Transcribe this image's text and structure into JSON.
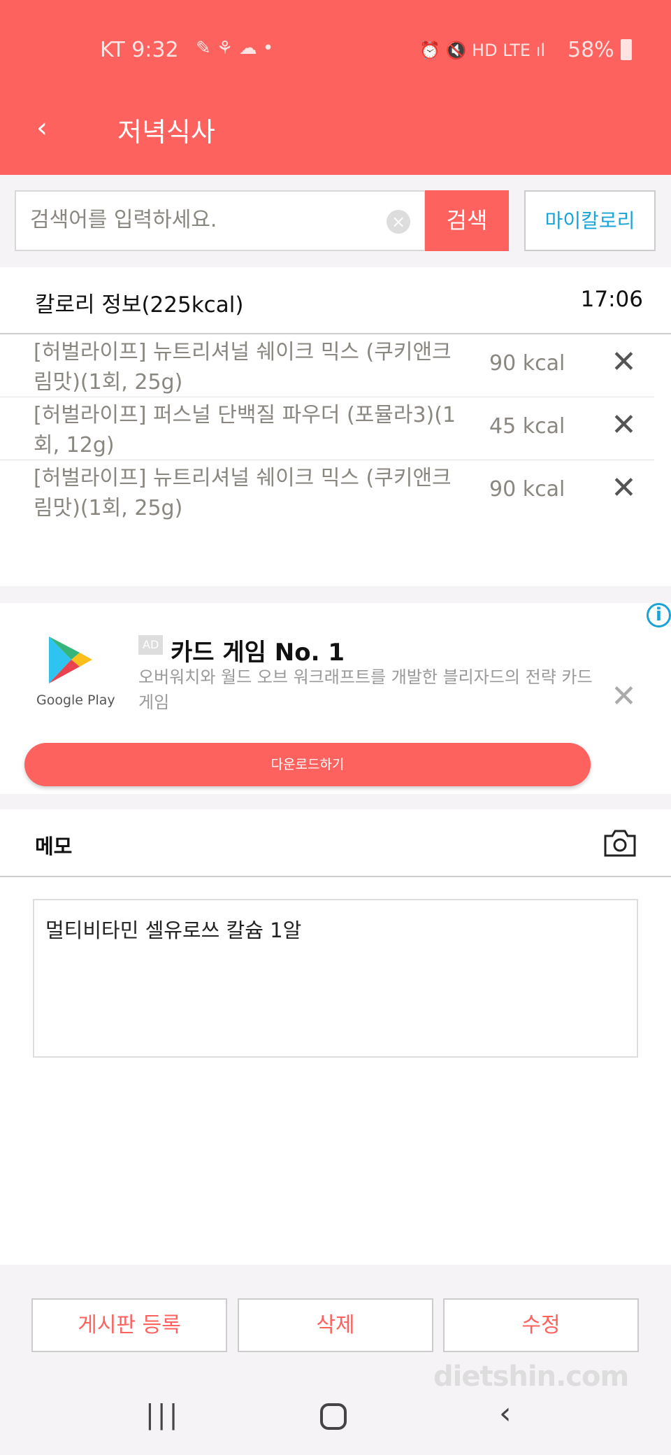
{
  "status_bar": {
    "carrier_time": "KT 9:32",
    "battery": "58%",
    "icons": [
      "pill-icon",
      "app-icon",
      "cloud-icon",
      "dot-icon",
      "alarm-icon",
      "mute-icon",
      "hd-icon",
      "lte-icon",
      "signal-icon",
      "battery-icon"
    ]
  },
  "header": {
    "title": "저녁식사",
    "back_icon": "chevron-left-icon"
  },
  "search": {
    "placeholder": "검색어를 입력하세요.",
    "value": "",
    "button": "검색",
    "my_calorie": "마이칼로리"
  },
  "calorie_info": {
    "title": "칼로리 정보(225kcal)",
    "time": "17:06",
    "items": [
      {
        "name": "[허벌라이프] 뉴트리셔널 쉐이크 믹스 (쿠키앤크림맛)(1회, 25g)",
        "kcal": "90 kcal"
      },
      {
        "name": "[허벌라이프] 퍼스널 단백질 파우더 (포뮬라3)(1회, 12g)",
        "kcal": "45 kcal"
      },
      {
        "name": "[허벌라이프] 뉴트리셔널 쉐이크 믹스 (쿠키앤크림맛)(1회, 25g)",
        "kcal": "90 kcal"
      }
    ]
  },
  "ad": {
    "logo_label": "Google Play",
    "badge": "AD",
    "title": "카드 게임 No. 1",
    "description": "오버워치와 월드 오브 워크래프트를 개발한 블리자드의 전략 카드 게임",
    "cta": "다운로드하기"
  },
  "memo": {
    "label": "메모",
    "text": "멀티비타민 셀유로쓰 칼슘 1알"
  },
  "buttons": {
    "post": "게시판 등록",
    "delete": "삭제",
    "edit": "수정"
  },
  "watermark": "dietshin.com",
  "colors": {
    "accent": "#fd625f",
    "link": "#1aa3d6"
  }
}
